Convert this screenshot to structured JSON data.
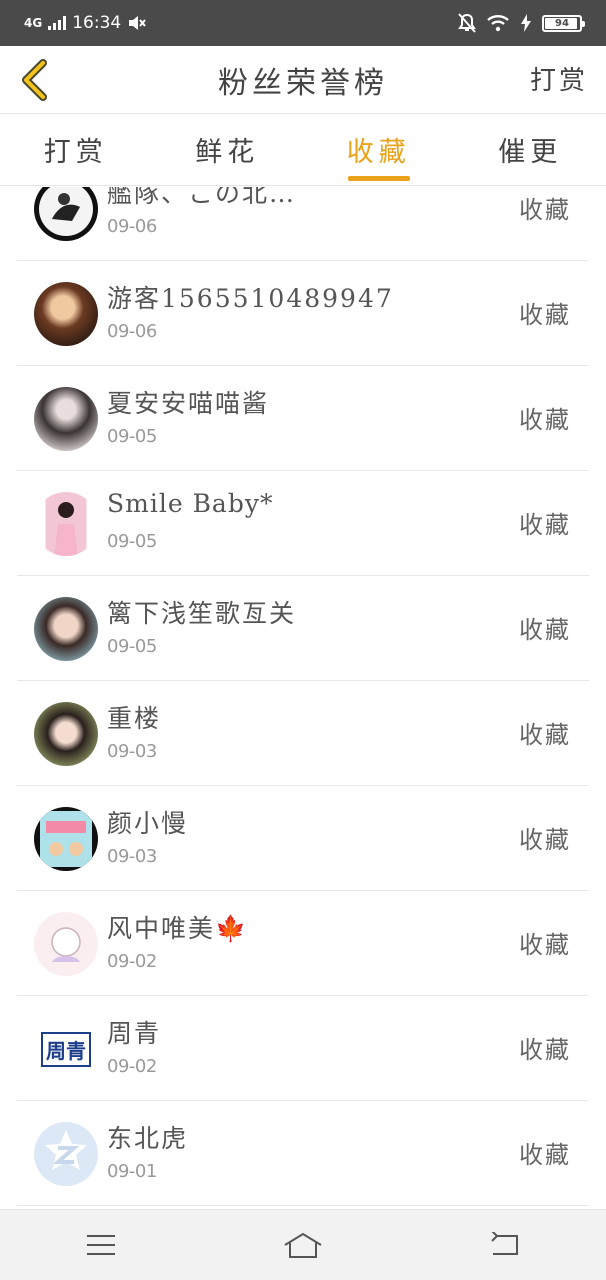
{
  "status_bar": {
    "network": "4G",
    "time": "16:34",
    "battery": "94",
    "battery_level": 0.94
  },
  "header": {
    "title": "粉丝荣誉榜",
    "action": "打赏"
  },
  "tabs": [
    {
      "label": "打赏",
      "active": false
    },
    {
      "label": "鲜花",
      "active": false
    },
    {
      "label": "收藏",
      "active": true
    },
    {
      "label": "催更",
      "active": false
    }
  ],
  "list": [
    {
      "name": "艦隊、この北…",
      "date": "09-06",
      "action": "收藏"
    },
    {
      "name": "游客1565510489947",
      "date": "09-06",
      "action": "收藏"
    },
    {
      "name": "夏安安喵喵酱",
      "date": "09-05",
      "action": "收藏"
    },
    {
      "name": "Smile  Baby*",
      "date": "09-05",
      "action": "收藏"
    },
    {
      "name": "篱下浅笙歌亙关",
      "date": "09-05",
      "action": "收藏"
    },
    {
      "name": "重楼",
      "date": "09-03",
      "action": "收藏"
    },
    {
      "name": "颜小慢",
      "date": "09-03",
      "action": "收藏"
    },
    {
      "name": "风中唯美🍁",
      "date": "09-02",
      "action": "收藏"
    },
    {
      "name": "周青",
      "date": "09-02",
      "action": "收藏"
    },
    {
      "name": "东北虎",
      "date": "09-01",
      "action": "收藏"
    }
  ],
  "avatar_labels": {
    "zhouqing": "周青"
  },
  "colors": {
    "accent": "#e9a21a",
    "status_bar": "#4a4a4a"
  }
}
